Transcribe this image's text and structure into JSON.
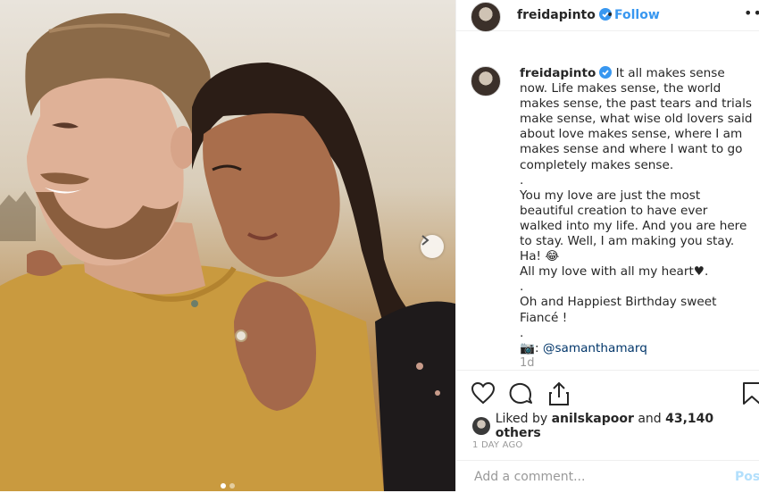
{
  "post": {
    "username": "freidapinto",
    "follow_label": "Follow",
    "bullet": "•",
    "more_label": "•••",
    "caption_username": "freidapinto",
    "caption_text": " It all makes sense now. Life makes sense, the world makes sense, the past tears and trials make sense, what wise old lovers said about love makes sense, where I am makes sense and where I want to go completely makes sense.\n.\nYou my love are just the most beautiful creation to have ever walked into my life. And you are here to stay. Well, I am making you stay. Ha! 😂\nAll my love with all my heart♥.\n.\nOh and Happiest Birthday sweet Fiancé !\n.\n",
    "credit_icon": "📷",
    "credit_sep": ": ",
    "mention": "@samanthamarq",
    "age": "1d"
  },
  "likes": {
    "prefix": "Liked by ",
    "liker": "anilskapoor",
    "and": " and ",
    "count": "43,140 others"
  },
  "timestamp": "1 DAY AGO",
  "comment_box": {
    "placeholder": "Add a comment...",
    "post_label": "Post"
  },
  "colors": {
    "accent": "#3897f0",
    "mention": "#003569",
    "muted": "#999999"
  }
}
